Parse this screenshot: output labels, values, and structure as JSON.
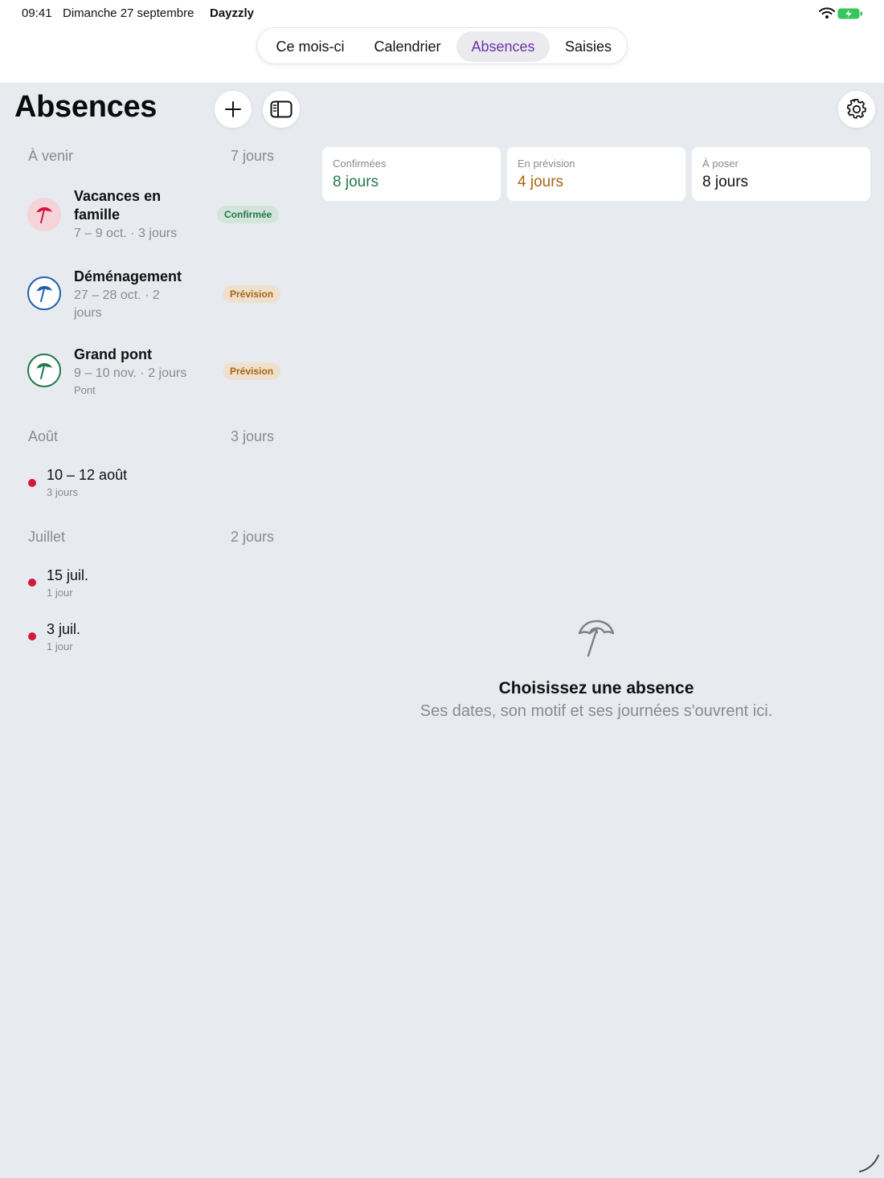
{
  "status_bar": {
    "time": "09:41",
    "date": "Dimanche 27 septembre",
    "app": "Dayzzly",
    "battery_color": "#34c759"
  },
  "tabs": [
    {
      "label": "Ce mois-ci",
      "active": false
    },
    {
      "label": "Calendrier",
      "active": false
    },
    {
      "label": "Absences",
      "active": true
    },
    {
      "label": "Saisies",
      "active": false
    }
  ],
  "header": {
    "title": "Absences",
    "add_icon": "plus-icon",
    "sidebar_icon": "sidebar-toggle-icon",
    "settings_icon": "gear-icon"
  },
  "upcoming": {
    "heading": "À venir",
    "total": "7 jours",
    "items": [
      {
        "title": "Vacances en famille",
        "sub": "7 – 9 oct. · 3 jours",
        "note": "",
        "badge": "Confirmée",
        "icon": "umbrella-icon",
        "color": "#d3173e"
      },
      {
        "title": "Déménagement",
        "sub": "27 – 28 oct. · 2 jours",
        "note": "",
        "badge": "Prévision",
        "icon": "umbrella-icon",
        "color": "#1f5fae"
      },
      {
        "title": "Grand pont",
        "sub": "9 – 10 nov. · 2 jours",
        "note": "Pont",
        "badge": "Prévision",
        "icon": "umbrella-icon",
        "color": "#23784a"
      }
    ]
  },
  "past": [
    {
      "heading": "Août",
      "total": "3 jours",
      "items": [
        {
          "title": "10 – 12 août",
          "sub": "3 jours"
        }
      ]
    },
    {
      "heading": "Juillet",
      "total": "2 jours",
      "items": [
        {
          "title": "15 juil.",
          "sub": "1 jour"
        },
        {
          "title": "3 juil.",
          "sub": "1 jour"
        }
      ]
    }
  ],
  "stats": [
    {
      "label": "Confirmées",
      "value": "8 jours",
      "color": "#23784a"
    },
    {
      "label": "En prévision",
      "value": "4 jours",
      "color": "#a8640f"
    },
    {
      "label": "À poser",
      "value": "8 jours",
      "color": "#111111"
    }
  ],
  "empty_state": {
    "icon": "umbrella-icon",
    "title": "Choisissez une absence",
    "subtitle": "Ses dates, son motif et ses journées s'ouvrent ici."
  },
  "colors": {
    "accent": "#6a33a6",
    "background": "#e7ebef",
    "past_dot": "#d3173e"
  }
}
